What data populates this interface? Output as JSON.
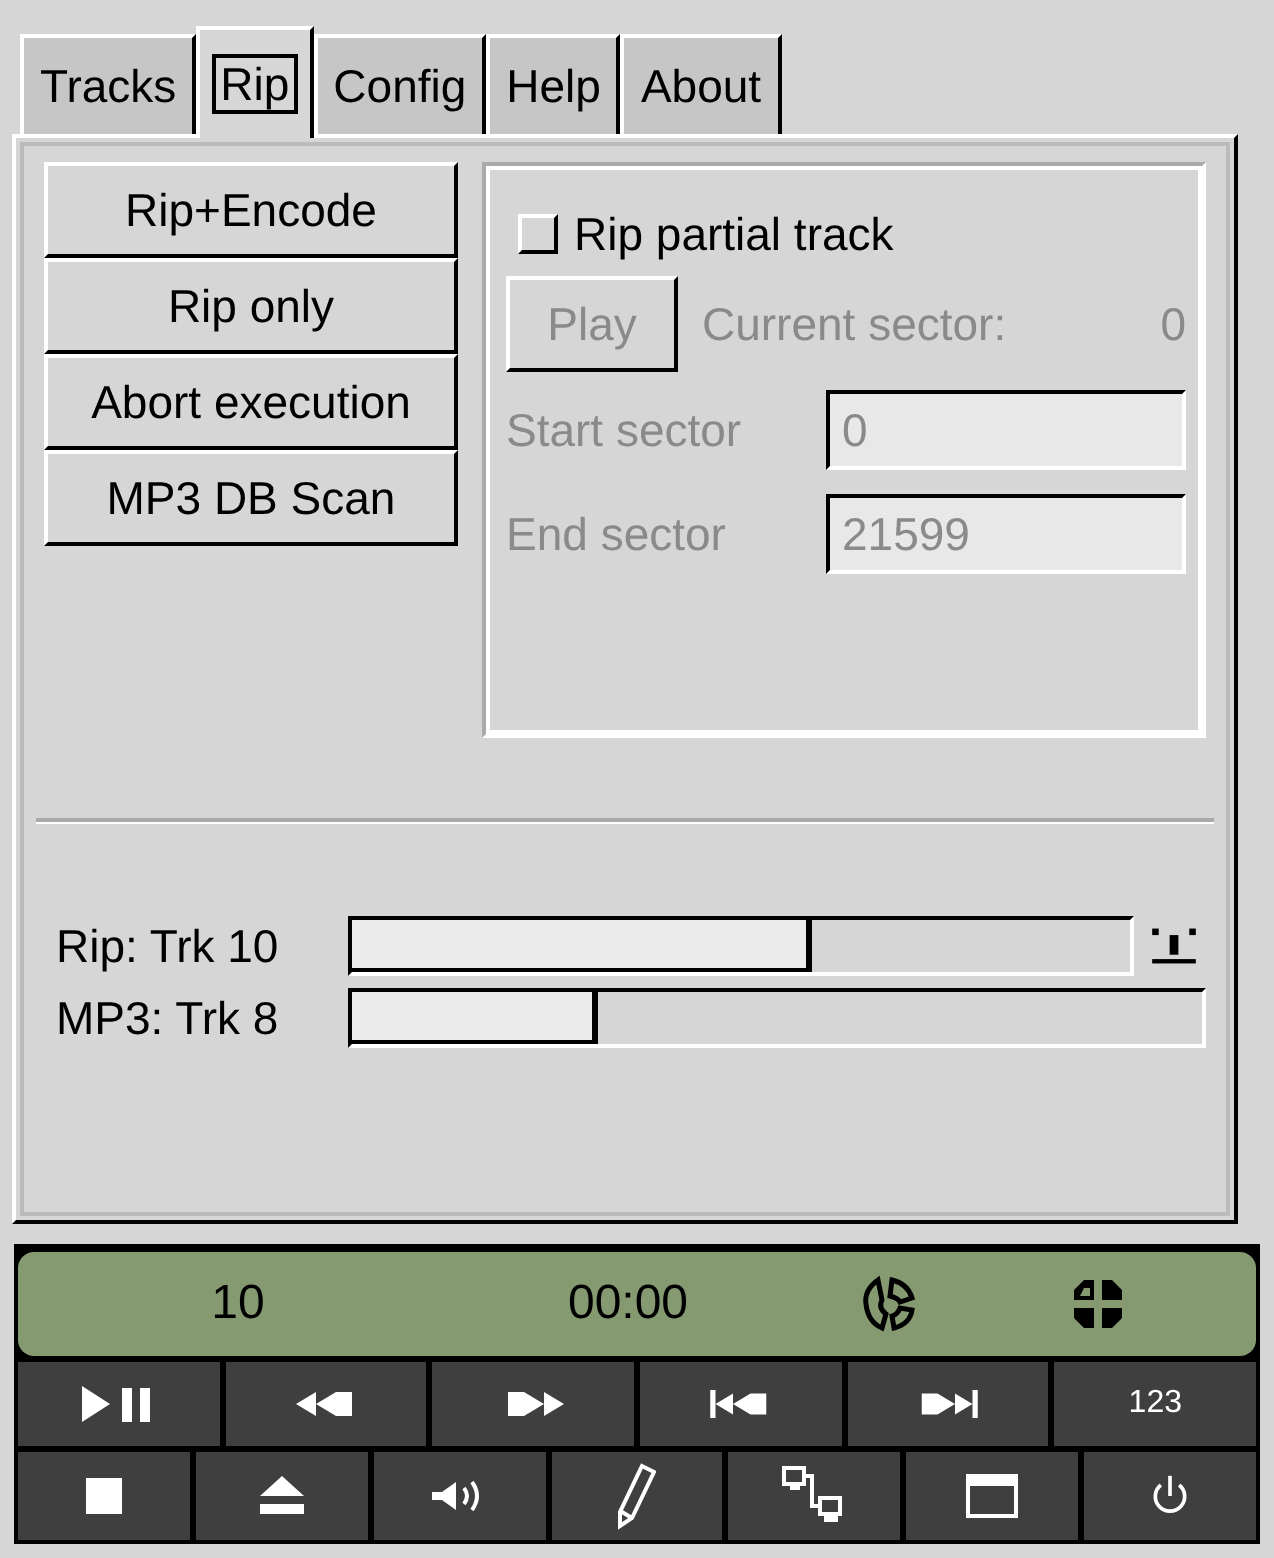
{
  "tabs": [
    {
      "label": "Tracks",
      "selected": false
    },
    {
      "label": "Rip",
      "selected": true
    },
    {
      "label": "Config",
      "selected": false
    },
    {
      "label": "Help",
      "selected": false
    },
    {
      "label": "About",
      "selected": false
    }
  ],
  "rip_buttons": [
    "Rip+Encode",
    "Rip only",
    "Abort execution",
    "MP3 DB Scan"
  ],
  "partial": {
    "checkbox": {
      "label": "Rip partial track",
      "checked": false
    },
    "play_button": {
      "label": "Play",
      "disabled": true
    },
    "current_sector": {
      "label": "Current sector:",
      "value": "0"
    },
    "fields": [
      {
        "label": "Start sector",
        "value": "0",
        "disabled": true
      },
      {
        "label": "End sector",
        "value": "21599",
        "disabled": true
      }
    ]
  },
  "progress": [
    {
      "label": "Rip: Trk 10",
      "level": 0.59
    },
    {
      "label": "MP3: Trk 8",
      "level": 0.29
    }
  ],
  "display": {
    "track": "10",
    "time": "00:00"
  },
  "track_list_button": "123"
}
